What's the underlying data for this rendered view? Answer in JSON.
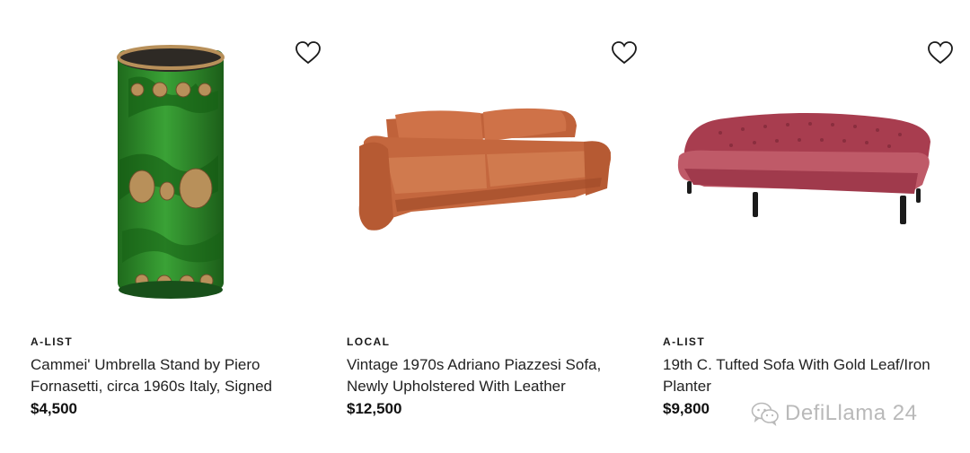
{
  "listings": [
    {
      "tag": "A-LIST",
      "title": "Cammei' Umbrella Stand by Piero Fornasetti, circa 1960s Italy, Signed",
      "price": "$4,500",
      "image": "umbrella-stand",
      "favorite_icon": "heart-outline-icon"
    },
    {
      "tag": "LOCAL",
      "title": "Vintage 1970s Adriano Piazzesi Sofa, Newly Upholstered With Leather",
      "price": "$12,500",
      "image": "leather-sofa",
      "favorite_icon": "heart-outline-icon"
    },
    {
      "tag": "A-LIST",
      "title": "19th C. Tufted Sofa With Gold Leaf/Iron Planter",
      "price": "$9,800",
      "image": "tufted-velvet-sofa",
      "favorite_icon": "heart-outline-icon"
    }
  ],
  "watermark": {
    "text": "DefiLlama 24",
    "icon": "wechat-icon"
  },
  "colors": {
    "text": "#1a1a1a",
    "watermark": "#b9b9b9",
    "stand_green": "#2f8a2a",
    "leather": "#c9693f",
    "velvet": "#b24a5a"
  }
}
